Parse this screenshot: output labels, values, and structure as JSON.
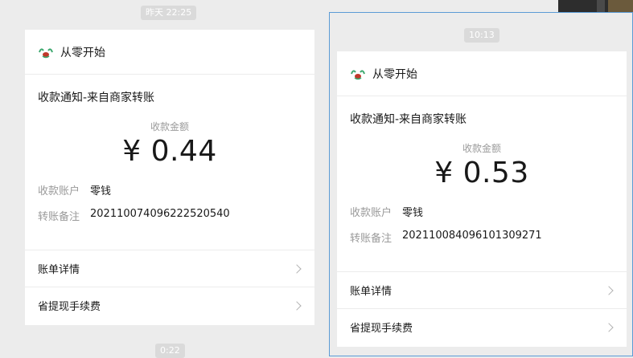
{
  "timestamps": {
    "left_top": "昨天 22:25",
    "right_top": "10:13",
    "left_bottom": "0:22"
  },
  "cards": [
    {
      "app_name": "从零开始",
      "notice_title": "收款通知-来自商家转账",
      "amount_label": "收款金额",
      "amount": "¥ 0.44",
      "account_key": "收款账户",
      "account_value": "零钱",
      "memo_key": "转账备注",
      "memo_value": "20211007409622252054​0",
      "links": [
        "账单详情",
        "省提现手续费"
      ]
    },
    {
      "app_name": "从零开始",
      "notice_title": "收款通知-来自商家转账",
      "amount_label": "收款金额",
      "amount": "¥ 0.53",
      "account_key": "收款账户",
      "account_value": "零钱",
      "memo_key": "转账备注",
      "memo_value": "20211008409610130927​1",
      "links": [
        "账单详情",
        "省提现手续费"
      ]
    }
  ]
}
